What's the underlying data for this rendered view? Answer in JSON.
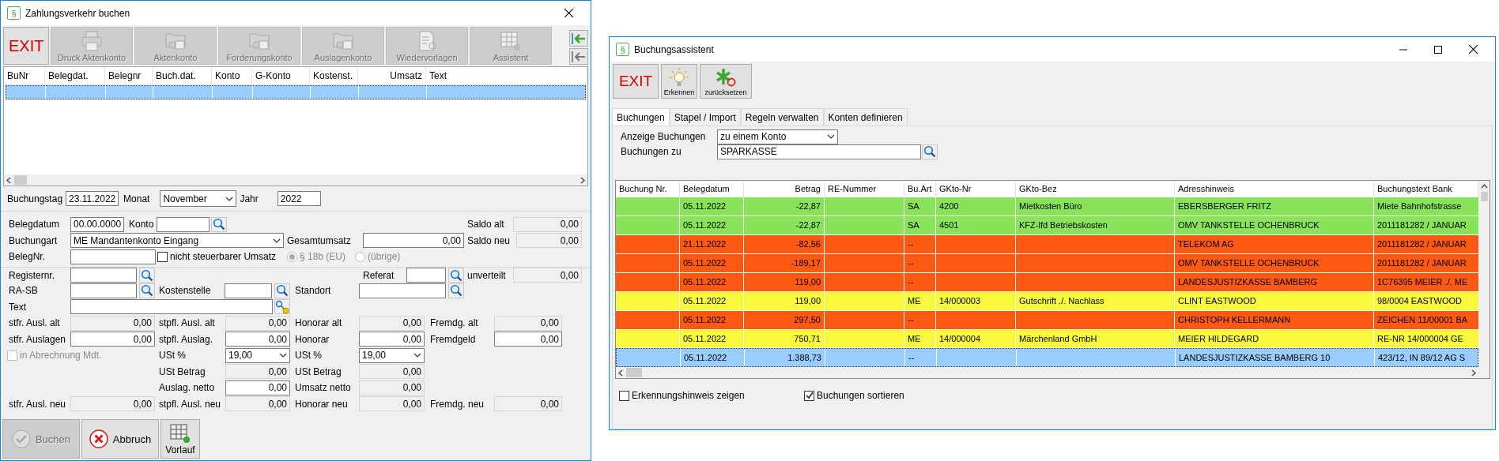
{
  "left_window": {
    "title": "Zahlungsverkehr buchen",
    "icon": "§",
    "toolbar": [
      {
        "label": "EXIT",
        "kind": "exit",
        "disabled": false
      },
      {
        "label": "Druck Aktenkonto",
        "kind": "printer",
        "disabled": true
      },
      {
        "label": "Aktenkonto",
        "kind": "folder",
        "disabled": true
      },
      {
        "label": "Forderungskonto",
        "kind": "folder",
        "disabled": true
      },
      {
        "label": "Auslagenkonto",
        "kind": "folder",
        "disabled": true
      },
      {
        "label": "Wiedervorlagen",
        "kind": "document",
        "disabled": true
      },
      {
        "label": "Assistent",
        "kind": "grid",
        "disabled": true
      }
    ],
    "side_buttons": [
      {
        "kind": "arrow-in"
      },
      {
        "kind": "arrow-out"
      }
    ],
    "table": {
      "columns": [
        "BuNr",
        "Belegdat.",
        "Belegnr",
        "Buch.dat.",
        "Konto",
        "G-Konto",
        "Kostenst.",
        "Umsatz",
        "Text"
      ],
      "rows": [
        {
          "selected": true
        }
      ]
    },
    "date_bar": {
      "buchungstag_label": "Buchungstag",
      "buchungstag": "23.11.2022",
      "monat_label": "Monat",
      "monat": "November",
      "jahr_label": "Jahr",
      "jahr": "2022"
    },
    "form": {
      "rows": [
        [
          {
            "kind": "label",
            "text": "Belegdatum"
          },
          {
            "kind": "input",
            "value": "00.00.0000"
          },
          {
            "kind": "label",
            "text": "Konto"
          },
          {
            "kind": "input"
          },
          {
            "kind": "search"
          },
          {
            "kind": "label",
            "text": "Saldo alt"
          },
          {
            "kind": "readonly",
            "value": "0,00"
          }
        ],
        [
          {
            "kind": "label",
            "text": "Buchungart"
          },
          {
            "kind": "select",
            "value": "ME Mandantenkonto Eingang"
          },
          {
            "kind": "label",
            "text": "Gesamtumsatz"
          },
          {
            "kind": "amount",
            "value": "0,00"
          },
          {
            "kind": "label",
            "text": "Saldo neu"
          },
          {
            "kind": "readonly",
            "value": "0,00"
          }
        ],
        [
          {
            "kind": "label",
            "text": "BelegNr."
          },
          {
            "kind": "input"
          },
          {
            "kind": "checkbox",
            "label": "nicht steuerbarer Umsatz",
            "checked": false,
            "disabled": false
          },
          {
            "kind": "radio",
            "label": "§ 18b (EU)",
            "selected": true,
            "disabled": true
          },
          {
            "kind": "radio",
            "label": "(übrige)",
            "selected": false,
            "disabled": true
          }
        ],
        [
          {
            "kind": "label",
            "text": "Registernr."
          },
          {
            "kind": "input"
          },
          {
            "kind": "search"
          },
          {
            "kind": "label",
            "text": "Referat"
          },
          {
            "kind": "input"
          },
          {
            "kind": "search"
          },
          {
            "kind": "label",
            "text": "unverteilt"
          },
          {
            "kind": "readonly",
            "value": "0,00"
          }
        ],
        [
          {
            "kind": "label",
            "text": "RA-SB"
          },
          {
            "kind": "input"
          },
          {
            "kind": "search"
          },
          {
            "kind": "label",
            "text": "Kostenstelle"
          },
          {
            "kind": "input"
          },
          {
            "kind": "search"
          },
          {
            "kind": "label",
            "text": "Standort"
          },
          {
            "kind": "input"
          },
          {
            "kind": "search"
          }
        ],
        [
          {
            "kind": "label",
            "text": "Text"
          },
          {
            "kind": "input"
          },
          {
            "kind": "key"
          }
        ],
        [
          {
            "kind": "label",
            "text": "stfr. Ausl. alt"
          },
          {
            "kind": "readonly",
            "value": "0,00"
          },
          {
            "kind": "label",
            "text": "stpfl. Ausl. alt"
          },
          {
            "kind": "readonly",
            "value": "0,00"
          },
          {
            "kind": "label",
            "text": "Honorar alt"
          },
          {
            "kind": "readonly",
            "value": "0,00"
          },
          {
            "kind": "label",
            "text": "Fremdg. alt"
          },
          {
            "kind": "readonly",
            "value": "0,00"
          }
        ],
        [
          {
            "kind": "label",
            "text": "stfr. Auslagen"
          },
          {
            "kind": "amount",
            "value": "0,00"
          },
          {
            "kind": "label",
            "text": "stpfl. Auslag."
          },
          {
            "kind": "amount",
            "value": "0,00"
          },
          {
            "kind": "label",
            "text": "Honorar"
          },
          {
            "kind": "amount",
            "value": "0,00"
          },
          {
            "kind": "label",
            "text": "Fremdgeld"
          },
          {
            "kind": "amount",
            "value": "0,00"
          }
        ],
        [
          {
            "kind": "checkbox",
            "label": "in Abrechnung Mdt.",
            "checked": false,
            "disabled": true
          },
          {
            "kind": "label",
            "text": "USt %"
          },
          {
            "kind": "select",
            "value": "19,00"
          },
          {
            "kind": "label",
            "text": "USt %"
          },
          {
            "kind": "select",
            "value": "19,00"
          }
        ],
        [
          {
            "kind": "label",
            "text": "USt Betrag"
          },
          {
            "kind": "readonly",
            "value": "0,00"
          },
          {
            "kind": "label",
            "text": "USt Betrag"
          },
          {
            "kind": "readonly",
            "value": "0,00"
          }
        ],
        [
          {
            "kind": "label",
            "text": "Auslag. netto"
          },
          {
            "kind": "amount",
            "value": "0,00"
          },
          {
            "kind": "label",
            "text": "Umsatz netto"
          },
          {
            "kind": "readonly",
            "value": "0,00"
          }
        ],
        [
          {
            "kind": "label",
            "text": "stfr. Ausl. neu"
          },
          {
            "kind": "readonly",
            "value": "0,00"
          },
          {
            "kind": "label",
            "text": "stpfl. Ausl. neu"
          },
          {
            "kind": "readonly",
            "value": "0,00"
          },
          {
            "kind": "label",
            "text": "Honorar neu"
          },
          {
            "kind": "readonly",
            "value": "0,00"
          },
          {
            "kind": "label",
            "text": "Fremdg. neu"
          },
          {
            "kind": "readonly",
            "value": "0,00"
          }
        ]
      ]
    },
    "buttons": [
      {
        "label": "Buchen",
        "kind": "check",
        "disabled": true
      },
      {
        "label": "Abbruch",
        "kind": "cancel",
        "disabled": false
      },
      {
        "label": "Vorlauf",
        "kind": "grid",
        "disabled": false
      }
    ]
  },
  "right_window": {
    "title": "Buchungsassistent",
    "icon": "§",
    "toolbar": [
      {
        "label": "EXIT",
        "kind": "exit"
      },
      {
        "label": "Erkennen",
        "kind": "bulb"
      },
      {
        "label": "zurücksetzen",
        "kind": "reset"
      }
    ],
    "tabs": [
      {
        "label": "Buchungen",
        "selected": true
      },
      {
        "label": "Stapel / Import",
        "selected": false
      },
      {
        "label": "Regeln verwalten",
        "selected": false
      },
      {
        "label": "Konten definieren",
        "selected": false
      }
    ],
    "filter": {
      "anzeige_label": "Anzeige Buchungen",
      "anzeige": "zu einem Konto",
      "zu_label": "Buchungen zu",
      "zu": "SPARKASSE"
    },
    "table": {
      "columns": [
        "Buchung Nr.",
        "Belegdatum",
        "Betrag",
        "RE-Nummer",
        "Bu.Art",
        "GKto-Nr",
        "GKto-Bez",
        "Adresshinweis",
        "Buchungstext Bank"
      ],
      "rows": [
        {
          "belegdatum": "05.11.2022",
          "betrag": "-22,87",
          "bu_art": "SA",
          "gkto_nr": "4200",
          "gkto_bez": "Mietkosten Büro",
          "adresshinweis": "EBERSBERGER FRITZ",
          "buchungstext_bank": "Miete Bahnhofstrasse",
          "color": "#88e25a",
          "selected": false
        },
        {
          "belegdatum": "05.11.2022",
          "betrag": "-22,87",
          "bu_art": "SA",
          "gkto_nr": "4501",
          "gkto_bez": "KFZ-lfd Betriebskosten",
          "adresshinweis": "OMV TANKSTELLE OCHENBRUCK",
          "buchungstext_bank": "2011181282 / JANUAR",
          "color": "#88e25a",
          "selected": false
        },
        {
          "belegdatum": "21.11.2022",
          "betrag": "-82,56",
          "bu_art": "--",
          "adresshinweis": "TELEKOM AG",
          "buchungstext_bank": "2011181282 / JANUAR",
          "color": "#fc5a12",
          "selected": false
        },
        {
          "belegdatum": "05.11.2022",
          "betrag": "-189,17",
          "bu_art": "--",
          "adresshinweis": "OMV TANKSTELLE OCHENBRUCK",
          "buchungstext_bank": "2011181282 / JANUAR",
          "color": "#fc5a12",
          "selected": false
        },
        {
          "belegdatum": "05.11.2022",
          "betrag": "119,00",
          "bu_art": "--",
          "adresshinweis": "LANDESJUSTIZKASSE BAMBERG",
          "buchungstext_bank": "1C76395 MEIER ./. ME",
          "color": "#fc5a12",
          "selected": false
        },
        {
          "belegdatum": "05.11.2022",
          "betrag": "119,00",
          "bu_art": "ME",
          "gkto_nr": "14/000003",
          "gkto_bez": "Gutschrift ./. Nachlass",
          "adresshinweis": "CLINT EASTWOOD",
          "buchungstext_bank": "98/0004 EASTWOOD",
          "color": "#f8f83c",
          "selected": false
        },
        {
          "belegdatum": "05.11.2022",
          "betrag": "297,50",
          "bu_art": "--",
          "adresshinweis": "CHRISTOPH KELLERMANN",
          "buchungstext_bank": "ZEICHEN 11/00001 BA",
          "color": "#fc5a12",
          "selected": false
        },
        {
          "belegdatum": "05.11.2022",
          "betrag": "750,71",
          "bu_art": "ME",
          "gkto_nr": "14/000004",
          "gkto_bez": "Märchenland GmbH",
          "adresshinweis": "MEIER HILDEGARD",
          "buchungstext_bank": "RE-NR 14/000004 GE",
          "color": "#f8f83c",
          "selected": false
        },
        {
          "belegdatum": "05.11.2022",
          "betrag": "1.388,73",
          "bu_art": "--",
          "adresshinweis": "LANDESJUSTIZKASSE BAMBERG 10",
          "buchungstext_bank": "423/12, IN 89/12 AG S",
          "selected": true
        }
      ]
    },
    "checkboxes": [
      {
        "label": "Erkennungshinweis zeigen",
        "checked": false
      },
      {
        "label": "Buchungen sortieren",
        "checked": true
      }
    ]
  }
}
